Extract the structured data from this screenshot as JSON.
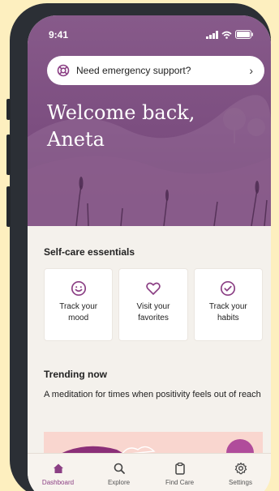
{
  "status_bar": {
    "time": "9:41"
  },
  "emergency": {
    "label": "Need emergency support?"
  },
  "hero": {
    "greeting": "Welcome back,",
    "name": "Aneta"
  },
  "self_care": {
    "title": "Self-care essentials",
    "cards": [
      {
        "icon": "smile-icon",
        "label": "Track your mood"
      },
      {
        "icon": "heart-icon",
        "label": "Visit your favorites"
      },
      {
        "icon": "check-circle-icon",
        "label": "Track your habits"
      }
    ]
  },
  "trending": {
    "title": "Trending now",
    "subtitle": "A meditation for times when positivity feels out of reach"
  },
  "nav": {
    "items": [
      {
        "label": "Dashboard",
        "icon": "home-icon",
        "active": true
      },
      {
        "label": "Explore",
        "icon": "search-icon",
        "active": false
      },
      {
        "label": "Find Care",
        "icon": "clipboard-icon",
        "active": false
      },
      {
        "label": "Settings",
        "icon": "gear-icon",
        "active": false
      }
    ]
  },
  "colors": {
    "brand": "#8b3f84",
    "hero": "#7c4e80",
    "background": "#fdefbf"
  }
}
